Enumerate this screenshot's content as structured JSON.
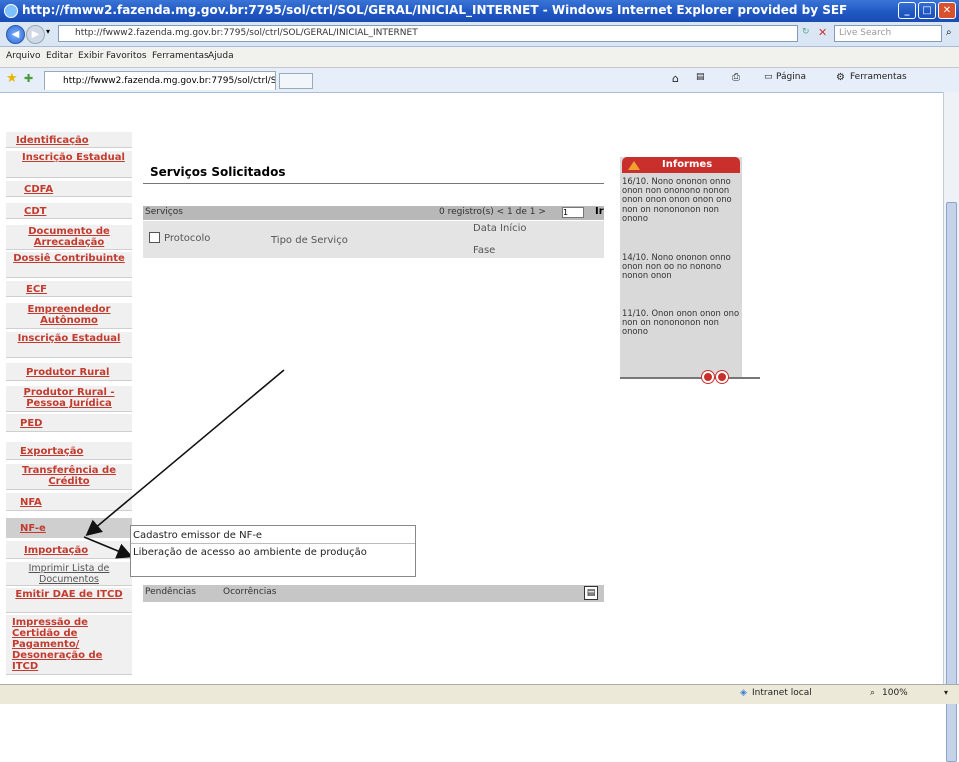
{
  "window": {
    "title": "http://fmww2.fazenda.mg.gov.br:7795/sol/ctrl/SOL/GERAL/INICIAL_INTERNET - Windows Internet Explorer provided by SEF"
  },
  "address": {
    "url": "http://fwww2.fazenda.mg.gov.br:7795/sol/ctrl/SOL/GERAL/INICIAL_INTERNET",
    "search_placeholder": "Live Search"
  },
  "menu": [
    "Arquivo",
    "Editar",
    "Exibir",
    "Favoritos",
    "Ferramentas",
    "Ajuda"
  ],
  "tabs": {
    "active": "http://fwww2.fazenda.mg.gov.br:7795/sol/ctrl/SOL/..."
  },
  "commands": {
    "page": "Página",
    "tools": "Ferramentas"
  },
  "sidebar": {
    "items": [
      "Identificação",
      "Inscrição Estadual",
      "CDFA",
      "CDT",
      "Documento de Arrecadação",
      "Dossiê Contribuinte",
      "ECF",
      "Empreendedor Autônomo",
      "Inscrição Estadual",
      "Produtor Rural",
      "Produtor Rural - Pessoa Jurídica",
      "PED",
      "Exportação",
      "Transferência de Crédito",
      "NFA",
      "NF-e",
      "Importação",
      "Imprimir Lista de Documentos",
      "Emitir DAE de ITCD",
      "Impressão de Certidão de Pagamento/ Desoneração de ITCD"
    ]
  },
  "main": {
    "title": "Serviços Solicitados",
    "grid": {
      "label": "Serviços",
      "records": "0 registro(s) < 1 de 1 >",
      "page": "1",
      "go": "Ir",
      "columns": [
        "Protocolo",
        "Tipo de Serviço",
        "Data Início",
        "Fase"
      ]
    },
    "bottom_tabs": [
      "Pendências",
      "Ocorrências"
    ]
  },
  "informes": {
    "title": "Informes",
    "news": [
      "16/10. Nono ononon onno onon non ononono nonon onon onon onon onon ono non on nonononon non onono",
      "14/10. Nono ononon onno onon non oo no nonono nonon onon",
      "11/10. Onon onon onon ono non on nonononon non onono"
    ]
  },
  "dropdown": {
    "items": [
      "Cadastro emissor de NF-e",
      "Liberação de acesso ao ambiente de produção"
    ]
  },
  "status": {
    "zone": "Intranet local",
    "zoom": "100%"
  },
  "colors": {
    "sidebar_link": "#c33b2e",
    "informes_header": "#c9302c"
  }
}
